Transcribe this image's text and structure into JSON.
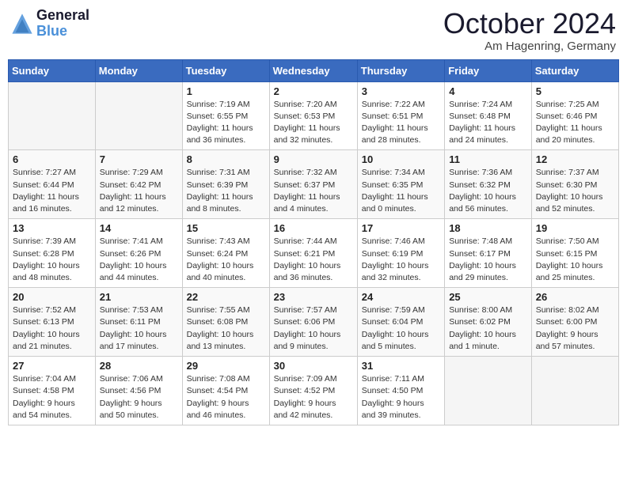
{
  "header": {
    "logo_line1": "General",
    "logo_line2": "Blue",
    "month_title": "October 2024",
    "location": "Am Hagenring, Germany"
  },
  "weekdays": [
    "Sunday",
    "Monday",
    "Tuesday",
    "Wednesday",
    "Thursday",
    "Friday",
    "Saturday"
  ],
  "weeks": [
    [
      {
        "day": "",
        "detail": ""
      },
      {
        "day": "",
        "detail": ""
      },
      {
        "day": "1",
        "detail": "Sunrise: 7:19 AM\nSunset: 6:55 PM\nDaylight: 11 hours\nand 36 minutes."
      },
      {
        "day": "2",
        "detail": "Sunrise: 7:20 AM\nSunset: 6:53 PM\nDaylight: 11 hours\nand 32 minutes."
      },
      {
        "day": "3",
        "detail": "Sunrise: 7:22 AM\nSunset: 6:51 PM\nDaylight: 11 hours\nand 28 minutes."
      },
      {
        "day": "4",
        "detail": "Sunrise: 7:24 AM\nSunset: 6:48 PM\nDaylight: 11 hours\nand 24 minutes."
      },
      {
        "day": "5",
        "detail": "Sunrise: 7:25 AM\nSunset: 6:46 PM\nDaylight: 11 hours\nand 20 minutes."
      }
    ],
    [
      {
        "day": "6",
        "detail": "Sunrise: 7:27 AM\nSunset: 6:44 PM\nDaylight: 11 hours\nand 16 minutes."
      },
      {
        "day": "7",
        "detail": "Sunrise: 7:29 AM\nSunset: 6:42 PM\nDaylight: 11 hours\nand 12 minutes."
      },
      {
        "day": "8",
        "detail": "Sunrise: 7:31 AM\nSunset: 6:39 PM\nDaylight: 11 hours\nand 8 minutes."
      },
      {
        "day": "9",
        "detail": "Sunrise: 7:32 AM\nSunset: 6:37 PM\nDaylight: 11 hours\nand 4 minutes."
      },
      {
        "day": "10",
        "detail": "Sunrise: 7:34 AM\nSunset: 6:35 PM\nDaylight: 11 hours\nand 0 minutes."
      },
      {
        "day": "11",
        "detail": "Sunrise: 7:36 AM\nSunset: 6:32 PM\nDaylight: 10 hours\nand 56 minutes."
      },
      {
        "day": "12",
        "detail": "Sunrise: 7:37 AM\nSunset: 6:30 PM\nDaylight: 10 hours\nand 52 minutes."
      }
    ],
    [
      {
        "day": "13",
        "detail": "Sunrise: 7:39 AM\nSunset: 6:28 PM\nDaylight: 10 hours\nand 48 minutes."
      },
      {
        "day": "14",
        "detail": "Sunrise: 7:41 AM\nSunset: 6:26 PM\nDaylight: 10 hours\nand 44 minutes."
      },
      {
        "day": "15",
        "detail": "Sunrise: 7:43 AM\nSunset: 6:24 PM\nDaylight: 10 hours\nand 40 minutes."
      },
      {
        "day": "16",
        "detail": "Sunrise: 7:44 AM\nSunset: 6:21 PM\nDaylight: 10 hours\nand 36 minutes."
      },
      {
        "day": "17",
        "detail": "Sunrise: 7:46 AM\nSunset: 6:19 PM\nDaylight: 10 hours\nand 32 minutes."
      },
      {
        "day": "18",
        "detail": "Sunrise: 7:48 AM\nSunset: 6:17 PM\nDaylight: 10 hours\nand 29 minutes."
      },
      {
        "day": "19",
        "detail": "Sunrise: 7:50 AM\nSunset: 6:15 PM\nDaylight: 10 hours\nand 25 minutes."
      }
    ],
    [
      {
        "day": "20",
        "detail": "Sunrise: 7:52 AM\nSunset: 6:13 PM\nDaylight: 10 hours\nand 21 minutes."
      },
      {
        "day": "21",
        "detail": "Sunrise: 7:53 AM\nSunset: 6:11 PM\nDaylight: 10 hours\nand 17 minutes."
      },
      {
        "day": "22",
        "detail": "Sunrise: 7:55 AM\nSunset: 6:08 PM\nDaylight: 10 hours\nand 13 minutes."
      },
      {
        "day": "23",
        "detail": "Sunrise: 7:57 AM\nSunset: 6:06 PM\nDaylight: 10 hours\nand 9 minutes."
      },
      {
        "day": "24",
        "detail": "Sunrise: 7:59 AM\nSunset: 6:04 PM\nDaylight: 10 hours\nand 5 minutes."
      },
      {
        "day": "25",
        "detail": "Sunrise: 8:00 AM\nSunset: 6:02 PM\nDaylight: 10 hours\nand 1 minute."
      },
      {
        "day": "26",
        "detail": "Sunrise: 8:02 AM\nSunset: 6:00 PM\nDaylight: 9 hours\nand 57 minutes."
      }
    ],
    [
      {
        "day": "27",
        "detail": "Sunrise: 7:04 AM\nSunset: 4:58 PM\nDaylight: 9 hours\nand 54 minutes."
      },
      {
        "day": "28",
        "detail": "Sunrise: 7:06 AM\nSunset: 4:56 PM\nDaylight: 9 hours\nand 50 minutes."
      },
      {
        "day": "29",
        "detail": "Sunrise: 7:08 AM\nSunset: 4:54 PM\nDaylight: 9 hours\nand 46 minutes."
      },
      {
        "day": "30",
        "detail": "Sunrise: 7:09 AM\nSunset: 4:52 PM\nDaylight: 9 hours\nand 42 minutes."
      },
      {
        "day": "31",
        "detail": "Sunrise: 7:11 AM\nSunset: 4:50 PM\nDaylight: 9 hours\nand 39 minutes."
      },
      {
        "day": "",
        "detail": ""
      },
      {
        "day": "",
        "detail": ""
      }
    ]
  ]
}
